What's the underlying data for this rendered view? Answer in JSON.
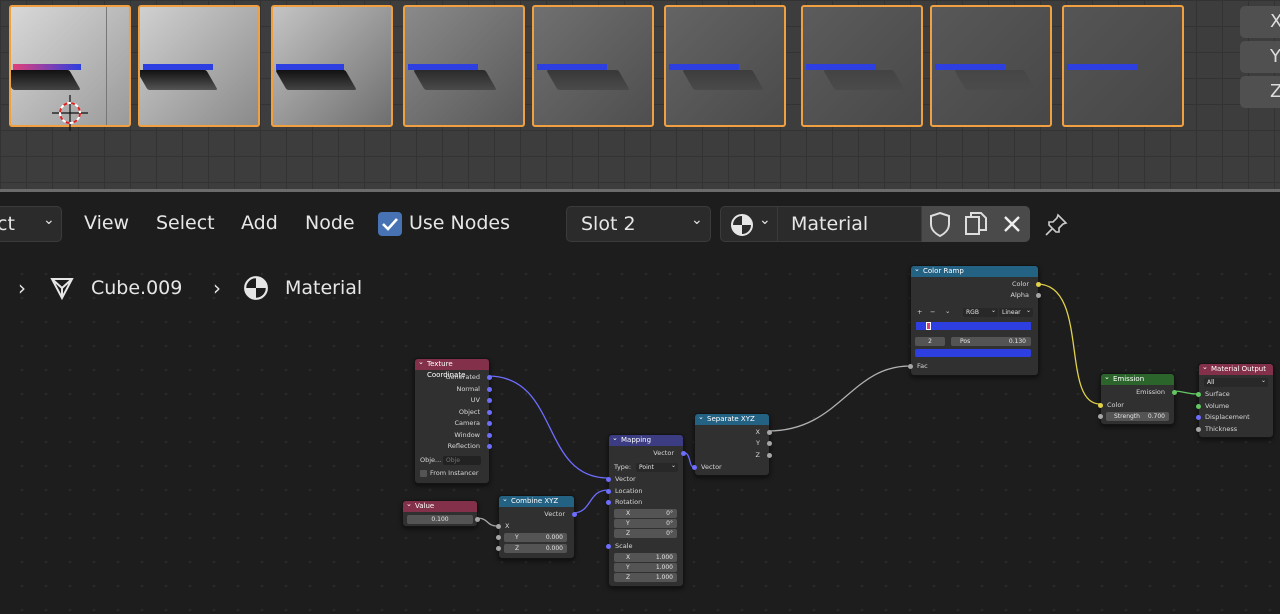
{
  "header": {
    "mode_partial": "ct",
    "menu": [
      "View",
      "Select",
      "Add",
      "Node"
    ],
    "use_nodes_label": "Use Nodes",
    "use_nodes_checked": true,
    "slot": "Slot 2",
    "material_name": "Material"
  },
  "axes": [
    "X",
    "Y",
    "Z"
  ],
  "breadcrumb": {
    "object": "Cube.009",
    "material": "Material"
  },
  "nodes": {
    "texture_coordinate": {
      "title": "Texture Coordinate",
      "outputs": [
        "Generated",
        "Normal",
        "UV",
        "Object",
        "Camera",
        "Window",
        "Reflection"
      ],
      "object_label": "Obje...",
      "object_placeholder": "Obje",
      "from_instancer": "From Instancer"
    },
    "value": {
      "title": "Value",
      "value": "0.100"
    },
    "combine_xyz": {
      "title": "Combine XYZ",
      "output": "Vector",
      "x_label": "X",
      "y_label": "Y",
      "y_value": "0.000",
      "z_label": "Z",
      "z_value": "0.000"
    },
    "mapping": {
      "title": "Mapping",
      "output": "Vector",
      "type_label": "Type:",
      "type_value": "Point",
      "vector": "Vector",
      "location": "Location",
      "rotation": "Rotation",
      "rot": [
        {
          "l": "X",
          "v": "0°"
        },
        {
          "l": "Y",
          "v": "0°"
        },
        {
          "l": "Z",
          "v": "0°"
        }
      ],
      "scale_label": "Scale",
      "scale": [
        {
          "l": "X",
          "v": "1.000"
        },
        {
          "l": "Y",
          "v": "1.000"
        },
        {
          "l": "Z",
          "v": "1.000"
        }
      ]
    },
    "separate_xyz": {
      "title": "Separate XYZ",
      "outputs": [
        "X",
        "Y",
        "Z"
      ],
      "input": "Vector"
    },
    "color_ramp": {
      "title": "Color Ramp",
      "outputs": [
        "Color",
        "Alpha"
      ],
      "plus": "+",
      "minus": "−",
      "chev": "⌄",
      "mode": "RGB",
      "interp": "Linear",
      "index": "2",
      "pos_label": "Pos",
      "pos_value": "0.130",
      "input": "Fac"
    },
    "emission": {
      "title": "Emission",
      "output": "Emission",
      "color": "Color",
      "strength_label": "Strength",
      "strength_value": "0.700"
    },
    "material_output": {
      "title": "Material Output",
      "target": "All",
      "inputs": [
        "Surface",
        "Volume",
        "Displacement",
        "Thickness"
      ]
    }
  },
  "colors": {
    "vector_socket": "#6d6dff",
    "color_socket": "#e0d24a",
    "shader_socket": "#63c763",
    "thumb_border": "#f0a040",
    "ramp_blue": "#2d3fe0"
  }
}
